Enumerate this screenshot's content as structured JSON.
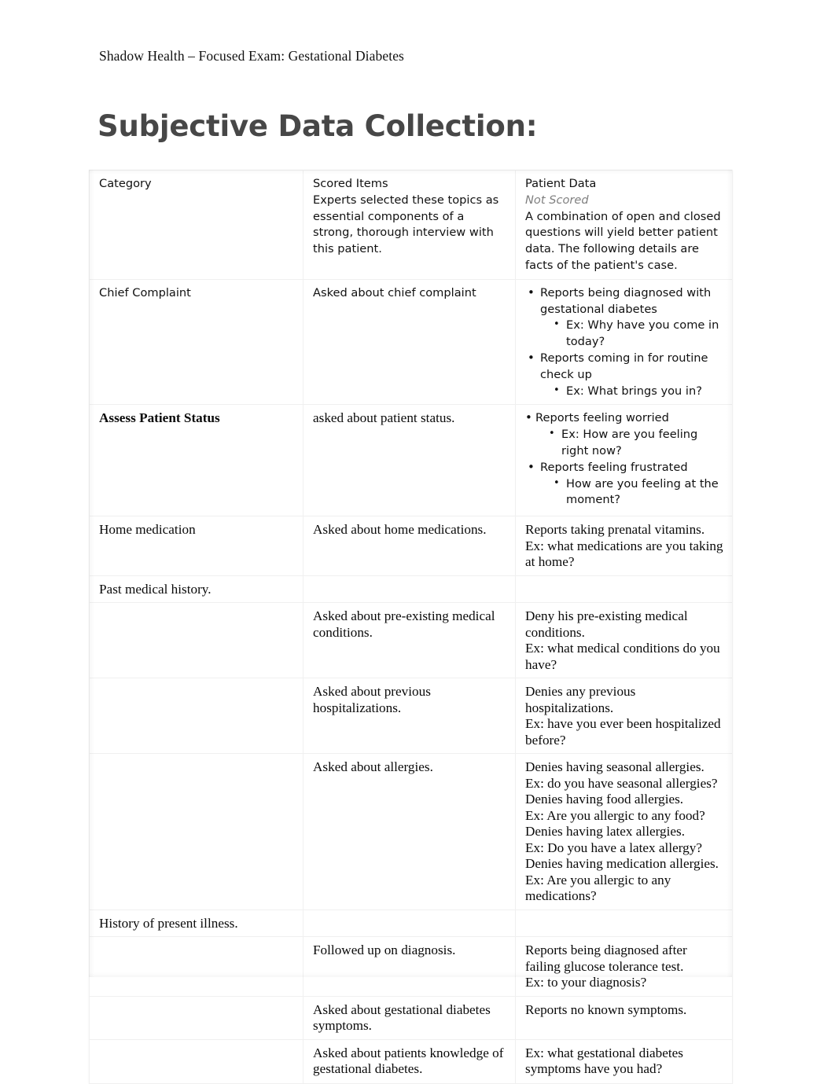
{
  "document": {
    "running_header": "Shadow Health – Focused Exam: Gestational Diabetes",
    "title": "Subjective Data Collection:"
  },
  "table": {
    "columns": [
      {
        "header": "Category"
      },
      {
        "header": "Scored Items",
        "subtitle": "Experts selected these topics as essential components of a strong, thorough interview with this patient."
      },
      {
        "header": "Patient Data",
        "not_scored": "Not Scored",
        "subtitle": "A combination of open and closed questions will yield better patient data. The following details are facts of the patient's case."
      }
    ],
    "rows": [
      {
        "category": "Chief Complaint",
        "scored_item": "Asked about chief complaint",
        "patient_data_bullets": [
          {
            "text": "Reports being diagnosed with gestational diabetes",
            "sub": "Ex: Why have you come in today?"
          },
          {
            "text": "Reports coming in for routine check up",
            "sub": "Ex: What brings you in?"
          }
        ]
      },
      {
        "category": "Assess Patient Status",
        "scored_item": "asked about patient status.",
        "patient_data_bullets": [
          {
            "text": "Reports feeling worried",
            "sub": "Ex: How are you feeling right now?"
          },
          {
            "text": "Reports feeling frustrated",
            "sub": "How are you feeling at the moment?"
          }
        ]
      },
      {
        "category": "Home medication",
        "scored_item": "Asked about home medications.",
        "patient_data_lines": [
          "Reports taking prenatal vitamins.",
          "Ex: what medications are you taking at home?"
        ]
      },
      {
        "category": "Past medical history.",
        "scored_item": "",
        "patient_data_lines": []
      },
      {
        "category": "",
        "scored_item": "Asked about pre-existing medical conditions.",
        "patient_data_lines": [
          "Deny his pre-existing medical conditions.",
          "Ex: what medical conditions do you have?"
        ]
      },
      {
        "category": "",
        "scored_item": "Asked about previous hospitalizations.",
        "patient_data_lines": [
          "Denies any previous hospitalizations.",
          "Ex: have you ever been hospitalized before?"
        ]
      },
      {
        "category": "",
        "scored_item": "Asked about allergies.",
        "patient_data_lines": [
          "Denies having seasonal allergies.",
          "Ex: do you have seasonal allergies?",
          "Denies having food allergies.",
          "Ex: Are you allergic to any food?",
          "Denies having latex allergies.",
          "Ex: Do you have a latex allergy?",
          "Denies having medication allergies.",
          "Ex: Are you allergic to any medications?"
        ]
      },
      {
        "category": "History of present illness.",
        "scored_item": "",
        "patient_data_lines": []
      },
      {
        "category": "",
        "scored_item": "Followed up on diagnosis.",
        "patient_data_lines": [
          "Reports being diagnosed after failing glucose tolerance test.",
          "Ex: to your diagnosis?"
        ]
      },
      {
        "category": "",
        "scored_item": "Asked about gestational diabetes symptoms.",
        "patient_data_lines": [
          "Reports no known symptoms."
        ]
      },
      {
        "category": "",
        "scored_item": "Asked about patients knowledge of gestational diabetes.",
        "patient_data_lines": [
          "Ex: what gestational diabetes symptoms have you had?"
        ]
      }
    ]
  },
  "glyphs": {
    "bullet": "•"
  }
}
